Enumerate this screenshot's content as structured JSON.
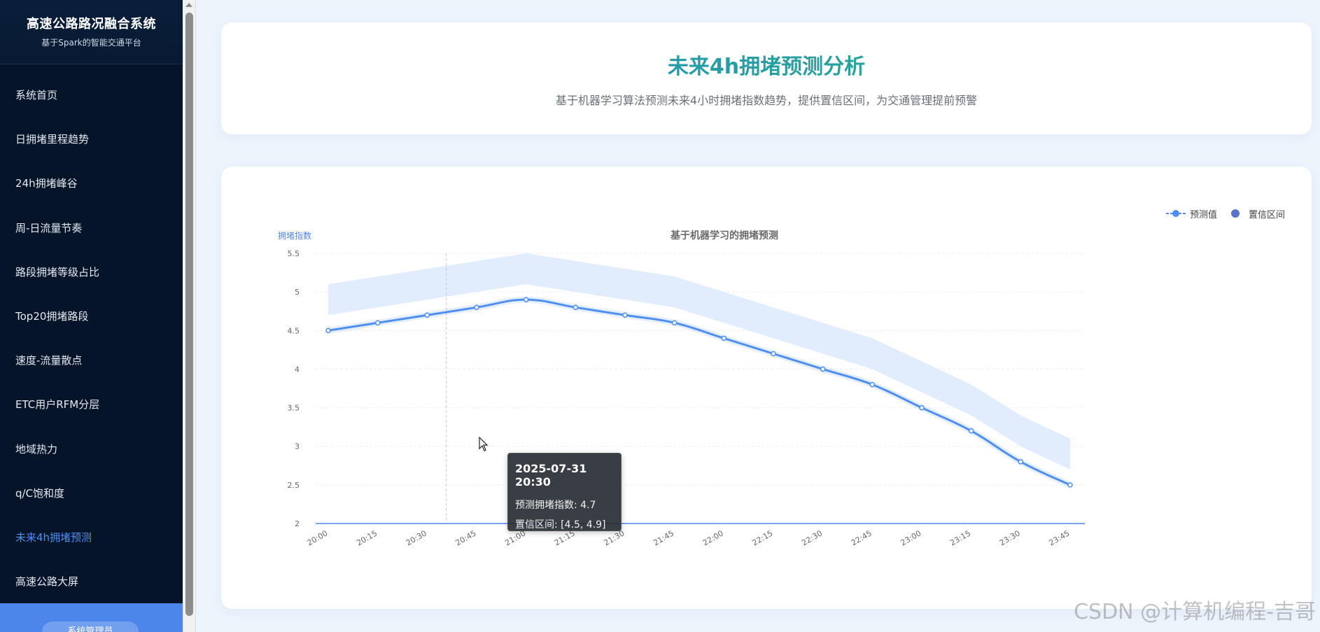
{
  "sidebar": {
    "title": "高速公路路况融合系统",
    "subtitle": "基于Spark的智能交通平台",
    "items": [
      {
        "label": "系统首页"
      },
      {
        "label": "日拥堵里程趋势"
      },
      {
        "label": "24h拥堵峰谷"
      },
      {
        "label": "周-日流量节奏"
      },
      {
        "label": "路段拥堵等级占比"
      },
      {
        "label": "Top20拥堵路段"
      },
      {
        "label": "速度-流量散点"
      },
      {
        "label": "ETC用户RFM分层"
      },
      {
        "label": "地域热力"
      },
      {
        "label": "q/C饱和度"
      },
      {
        "label": "未来4h拥堵预测",
        "active": true
      },
      {
        "label": "高速公路大屏"
      }
    ],
    "footer_label": "系统管理员"
  },
  "header": {
    "title": "未来4h拥堵预测分析",
    "subtitle": "基于机器学习算法预测未来4小时拥堵指数趋势，提供置信区间，为交通管理提前预警"
  },
  "legend": {
    "items": [
      "预测值",
      "置信区间"
    ]
  },
  "tooltip": {
    "title": "2025-07-31 20:30",
    "row1": "预测拥堵指数: 4.7",
    "row2": "置信区间: [4.5, 4.9]"
  },
  "watermark": "CSDN @计算机编程-吉哥",
  "colors": {
    "line": "#4f8ff0",
    "band": "#dce9fb",
    "axis": "#4f86e8",
    "active_menu": "#4d8ef7"
  },
  "chart_data": {
    "type": "line",
    "title": "基于机器学习的拥堵预测",
    "ylabel": "拥堵指数",
    "xlabel": "",
    "ylim": [
      2,
      5.5
    ],
    "yticks": [
      2,
      2.5,
      3,
      3.5,
      4,
      4.5,
      5,
      5.5
    ],
    "categories": [
      "20:00",
      "20:15",
      "20:30",
      "20:45",
      "21:00",
      "21:15",
      "21:30",
      "21:45",
      "22:00",
      "22:15",
      "22:30",
      "22:45",
      "23:00",
      "23:15",
      "23:30",
      "23:45"
    ],
    "series": [
      {
        "name": "预测值",
        "values": [
          4.5,
          4.6,
          4.7,
          4.8,
          4.9,
          4.8,
          4.7,
          4.6,
          4.4,
          4.2,
          4.0,
          3.8,
          3.5,
          3.2,
          2.8,
          2.5
        ]
      }
    ],
    "confidence_interval": {
      "name": "置信区间",
      "lower": [
        4.7,
        4.8,
        4.9,
        5.0,
        5.1,
        5.0,
        4.9,
        4.8,
        4.6,
        4.4,
        4.2,
        4.0,
        3.7,
        3.4,
        3.0,
        2.7
      ],
      "upper": [
        5.1,
        5.2,
        5.3,
        5.4,
        5.5,
        5.4,
        5.3,
        5.2,
        5.0,
        4.8,
        4.6,
        4.4,
        4.1,
        3.8,
        3.4,
        3.1
      ]
    },
    "legend_position": "top-right",
    "grid": true
  }
}
